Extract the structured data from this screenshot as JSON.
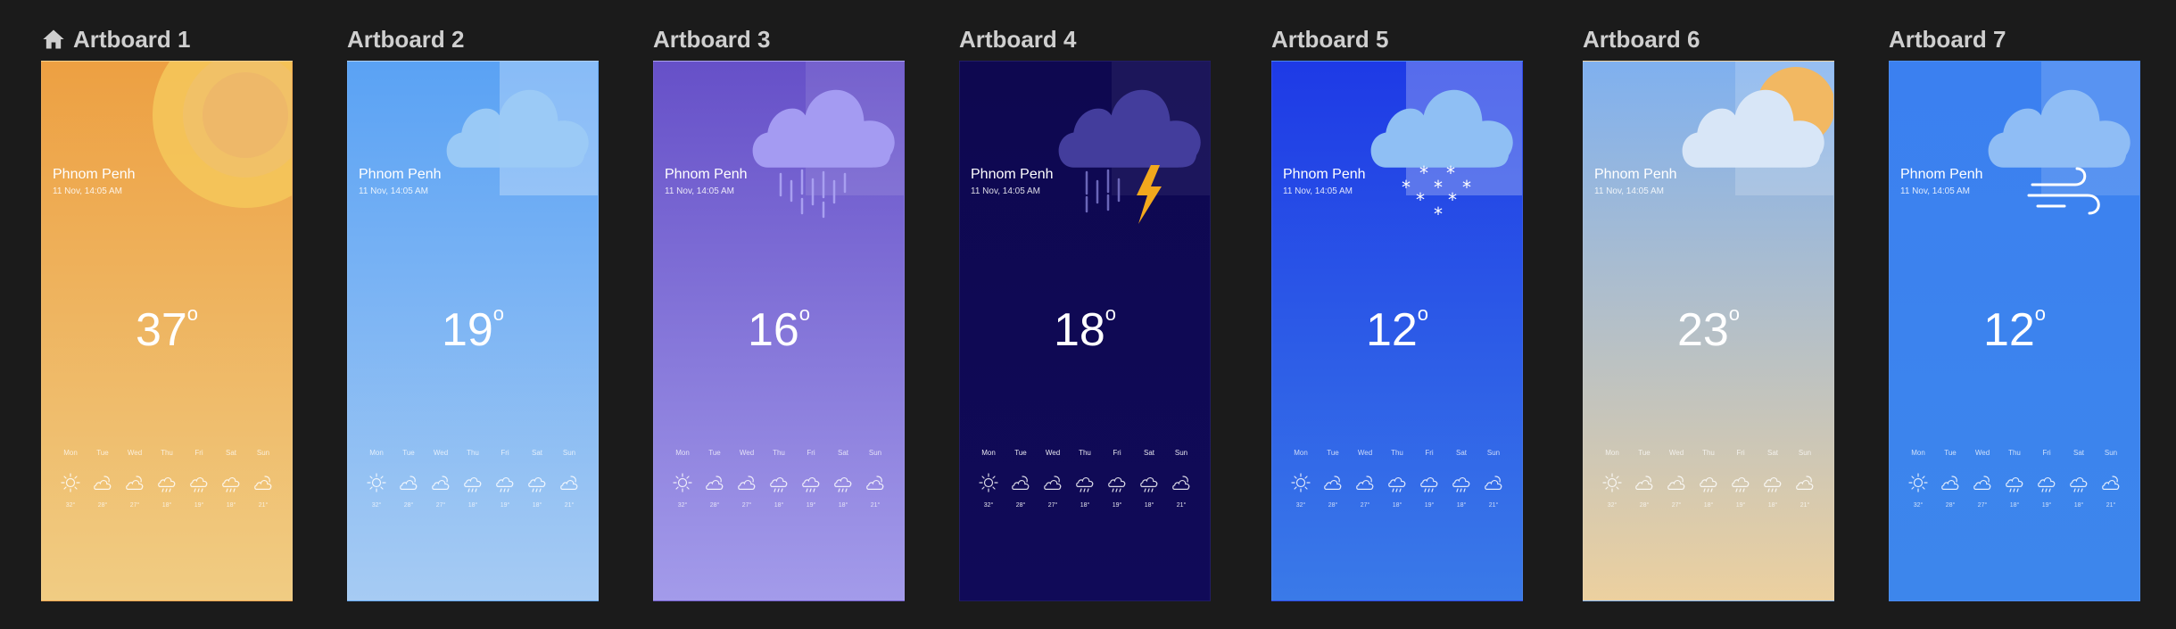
{
  "colors": {
    "background": "#1b1b1b",
    "title_text": "#cfcfcf",
    "sun": "#f2c052",
    "lightning": "#f2a81d"
  },
  "artboards": [
    {
      "title": "Artboard 1",
      "has_home_icon": true,
      "hero": "sun",
      "gradient": [
        "#eda042",
        "#f0cc83"
      ],
      "city": "Phnom Penh",
      "date": "11 Nov, 14:05 AM",
      "temp": "37",
      "degree_symbol": "o",
      "week": {
        "days": [
          "Mon",
          "Tue",
          "Wed",
          "Thu",
          "Fri",
          "Sat",
          "Sun"
        ],
        "icons": [
          "sun-icon",
          "cloud-sun-icon",
          "cloud-sun-icon",
          "cloud-rain-icon",
          "cloud-rain-icon",
          "cloud-rain-icon",
          "cloud-sun-icon"
        ],
        "temps": [
          "32°",
          "28°",
          "27°",
          "18°",
          "19°",
          "18°",
          "21°"
        ]
      }
    },
    {
      "title": "Artboard 2",
      "has_home_icon": false,
      "hero": "cloud",
      "gradient": [
        "#5aa2f4",
        "#a6cbf3"
      ],
      "city": "Phnom Penh",
      "date": "11 Nov, 14:05 AM",
      "temp": "19",
      "degree_symbol": "o",
      "week": {
        "days": [
          "Mon",
          "Tue",
          "Wed",
          "Thu",
          "Fri",
          "Sat",
          "Sun"
        ],
        "icons": [
          "sun-icon",
          "cloud-sun-icon",
          "cloud-sun-icon",
          "cloud-rain-icon",
          "cloud-rain-icon",
          "cloud-rain-icon",
          "cloud-sun-icon"
        ],
        "temps": [
          "32°",
          "28°",
          "27°",
          "18°",
          "19°",
          "18°",
          "21°"
        ]
      }
    },
    {
      "title": "Artboard 3",
      "has_home_icon": false,
      "hero": "rain",
      "gradient": [
        "#6650c8",
        "#a39bea"
      ],
      "city": "Phnom Penh",
      "date": "11 Nov, 14:05 AM",
      "temp": "16",
      "degree_symbol": "o",
      "week": {
        "days": [
          "Mon",
          "Tue",
          "Wed",
          "Thu",
          "Fri",
          "Sat",
          "Sun"
        ],
        "icons": [
          "sun-icon",
          "cloud-sun-icon",
          "cloud-sun-icon",
          "cloud-rain-icon",
          "cloud-rain-icon",
          "cloud-rain-icon",
          "cloud-sun-icon"
        ],
        "temps": [
          "32°",
          "28°",
          "27°",
          "18°",
          "19°",
          "18°",
          "21°"
        ]
      }
    },
    {
      "title": "Artboard 4",
      "has_home_icon": false,
      "hero": "storm",
      "gradient": [
        "#0e0850",
        "#100a58"
      ],
      "city": "Phnom Penh",
      "date": "11 Nov, 14:05 AM",
      "temp": "18",
      "degree_symbol": "o",
      "week": {
        "days": [
          "Mon",
          "Tue",
          "Wed",
          "Thu",
          "Fri",
          "Sat",
          "Sun"
        ],
        "icons": [
          "sun-icon",
          "cloud-sun-icon",
          "cloud-sun-icon",
          "cloud-rain-icon",
          "cloud-rain-icon",
          "cloud-rain-icon",
          "cloud-sun-icon"
        ],
        "temps": [
          "32°",
          "28°",
          "27°",
          "18°",
          "19°",
          "18°",
          "21°"
        ]
      }
    },
    {
      "title": "Artboard 5",
      "has_home_icon": false,
      "hero": "snow",
      "gradient": [
        "#1e3ae6",
        "#3a7ae8"
      ],
      "city": "Phnom Penh",
      "date": "11 Nov, 14:05 AM",
      "temp": "12",
      "degree_symbol": "o",
      "week": {
        "days": [
          "Mon",
          "Tue",
          "Wed",
          "Thu",
          "Fri",
          "Sat",
          "Sun"
        ],
        "icons": [
          "sun-icon",
          "cloud-sun-icon",
          "cloud-sun-icon",
          "cloud-rain-icon",
          "cloud-rain-icon",
          "cloud-rain-icon",
          "cloud-sun-icon"
        ],
        "temps": [
          "32°",
          "28°",
          "27°",
          "18°",
          "19°",
          "18°",
          "21°"
        ]
      }
    },
    {
      "title": "Artboard 6",
      "has_home_icon": false,
      "hero": "cloud-sun",
      "gradient": [
        "#7fb0ef",
        "#ecd09f"
      ],
      "city": "Phnom Penh",
      "date": "11 Nov, 14:05 AM",
      "temp": "23",
      "degree_symbol": "o",
      "week": {
        "days": [
          "Mon",
          "Tue",
          "Wed",
          "Thu",
          "Fri",
          "Sat",
          "Sun"
        ],
        "icons": [
          "sun-icon",
          "cloud-sun-icon",
          "cloud-sun-icon",
          "cloud-rain-icon",
          "cloud-rain-icon",
          "cloud-rain-icon",
          "cloud-sun-icon"
        ],
        "temps": [
          "32°",
          "28°",
          "27°",
          "18°",
          "19°",
          "18°",
          "21°"
        ]
      }
    },
    {
      "title": "Artboard 7",
      "has_home_icon": false,
      "hero": "wind",
      "gradient": [
        "#3b80f0",
        "#3d86ec"
      ],
      "city": "Phnom Penh",
      "date": "11 Nov, 14:05 AM",
      "temp": "12",
      "degree_symbol": "o",
      "week": {
        "days": [
          "Mon",
          "Tue",
          "Wed",
          "Thu",
          "Fri",
          "Sat",
          "Sun"
        ],
        "icons": [
          "sun-icon",
          "cloud-sun-icon",
          "cloud-sun-icon",
          "cloud-rain-icon",
          "cloud-rain-icon",
          "cloud-rain-icon",
          "cloud-sun-icon"
        ],
        "temps": [
          "32°",
          "28°",
          "27°",
          "18°",
          "19°",
          "18°",
          "21°"
        ]
      }
    }
  ]
}
